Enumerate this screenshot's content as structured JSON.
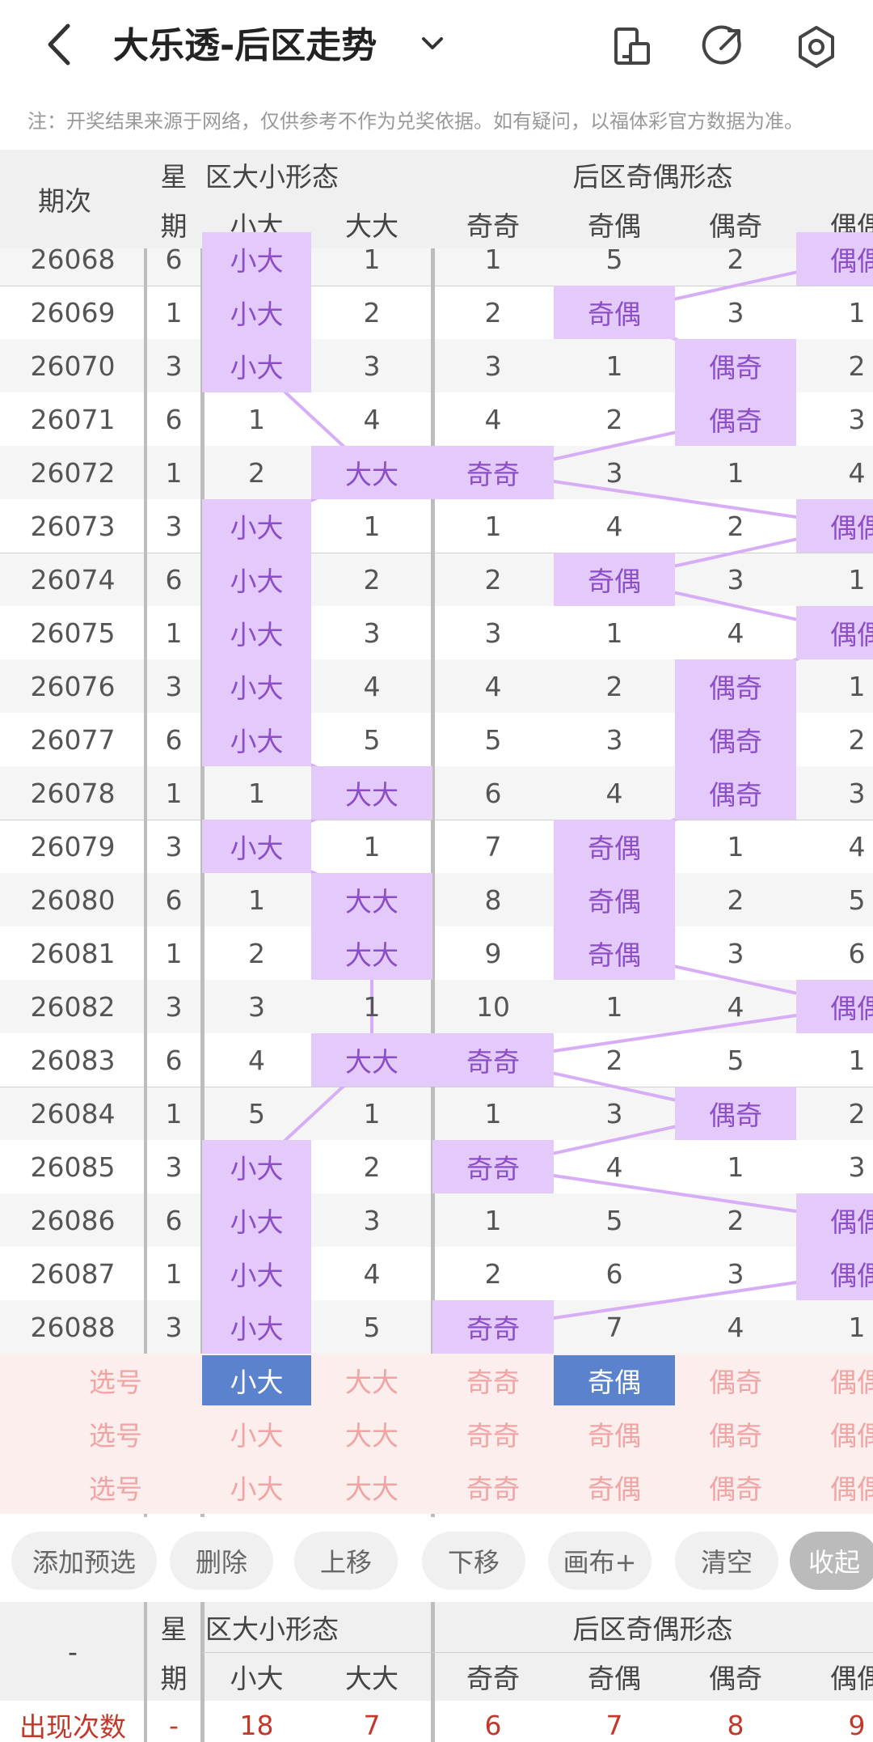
{
  "header": {
    "title": "大乐透-后区走势",
    "notice": "注：开奖结果来源于网络，仅供参考不作为兑奖依据。如有疑问，以福体彩官方数据为准。"
  },
  "table": {
    "col_period": "期次",
    "col_week_line1": "星",
    "col_week_line2": "期",
    "group_size": "区大小形态",
    "group_parity": "后区奇偶形态",
    "size_cols": [
      "小大",
      "大大"
    ],
    "parity_cols": [
      "奇奇",
      "奇偶",
      "偶奇",
      "偶偶"
    ],
    "rows": [
      {
        "p": "26068",
        "w": "6",
        "c": [
          "小大",
          "1",
          "1",
          "5",
          "2",
          "偶偶"
        ]
      },
      {
        "p": "26069",
        "w": "1",
        "c": [
          "小大",
          "2",
          "2",
          "奇偶",
          "3",
          "1"
        ]
      },
      {
        "p": "26070",
        "w": "3",
        "c": [
          "小大",
          "3",
          "3",
          "1",
          "偶奇",
          "2"
        ]
      },
      {
        "p": "26071",
        "w": "6",
        "c": [
          "1",
          "4",
          "4",
          "2",
          "偶奇",
          "3"
        ]
      },
      {
        "p": "26072",
        "w": "1",
        "c": [
          "2",
          "大大",
          "奇奇",
          "3",
          "1",
          "4"
        ]
      },
      {
        "p": "26073",
        "w": "3",
        "c": [
          "小大",
          "1",
          "1",
          "4",
          "2",
          "偶偶"
        ]
      },
      {
        "p": "26074",
        "w": "6",
        "c": [
          "小大",
          "2",
          "2",
          "奇偶",
          "3",
          "1"
        ]
      },
      {
        "p": "26075",
        "w": "1",
        "c": [
          "小大",
          "3",
          "3",
          "1",
          "4",
          "偶偶"
        ]
      },
      {
        "p": "26076",
        "w": "3",
        "c": [
          "小大",
          "4",
          "4",
          "2",
          "偶奇",
          "1"
        ]
      },
      {
        "p": "26077",
        "w": "6",
        "c": [
          "小大",
          "5",
          "5",
          "3",
          "偶奇",
          "2"
        ]
      },
      {
        "p": "26078",
        "w": "1",
        "c": [
          "1",
          "大大",
          "6",
          "4",
          "偶奇",
          "3"
        ]
      },
      {
        "p": "26079",
        "w": "3",
        "c": [
          "小大",
          "1",
          "7",
          "奇偶",
          "1",
          "4"
        ]
      },
      {
        "p": "26080",
        "w": "6",
        "c": [
          "1",
          "大大",
          "8",
          "奇偶",
          "2",
          "5"
        ]
      },
      {
        "p": "26081",
        "w": "1",
        "c": [
          "2",
          "大大",
          "9",
          "奇偶",
          "3",
          "6"
        ]
      },
      {
        "p": "26082",
        "w": "3",
        "c": [
          "3",
          "1",
          "10",
          "1",
          "4",
          "偶偶"
        ]
      },
      {
        "p": "26083",
        "w": "6",
        "c": [
          "4",
          "大大",
          "奇奇",
          "2",
          "5",
          "1"
        ]
      },
      {
        "p": "26084",
        "w": "1",
        "c": [
          "5",
          "1",
          "1",
          "3",
          "偶奇",
          "2"
        ]
      },
      {
        "p": "26085",
        "w": "3",
        "c": [
          "小大",
          "2",
          "奇奇",
          "4",
          "1",
          "3"
        ]
      },
      {
        "p": "26086",
        "w": "6",
        "c": [
          "小大",
          "3",
          "1",
          "5",
          "2",
          "偶偶"
        ]
      },
      {
        "p": "26087",
        "w": "1",
        "c": [
          "小大",
          "4",
          "2",
          "6",
          "3",
          "偶偶"
        ]
      },
      {
        "p": "26088",
        "w": "3",
        "c": [
          "小大",
          "5",
          "奇奇",
          "7",
          "4",
          "1"
        ]
      }
    ],
    "select_label": "选号"
  },
  "buttons": [
    "添加预选",
    "删除",
    "上移",
    "下移",
    "画布+",
    "清空",
    "收起"
  ],
  "stats": {
    "first_col": "-",
    "row_label": "出现次数",
    "row_week": "-",
    "values": [
      "18",
      "7",
      "6",
      "7",
      "8",
      "9"
    ]
  }
}
